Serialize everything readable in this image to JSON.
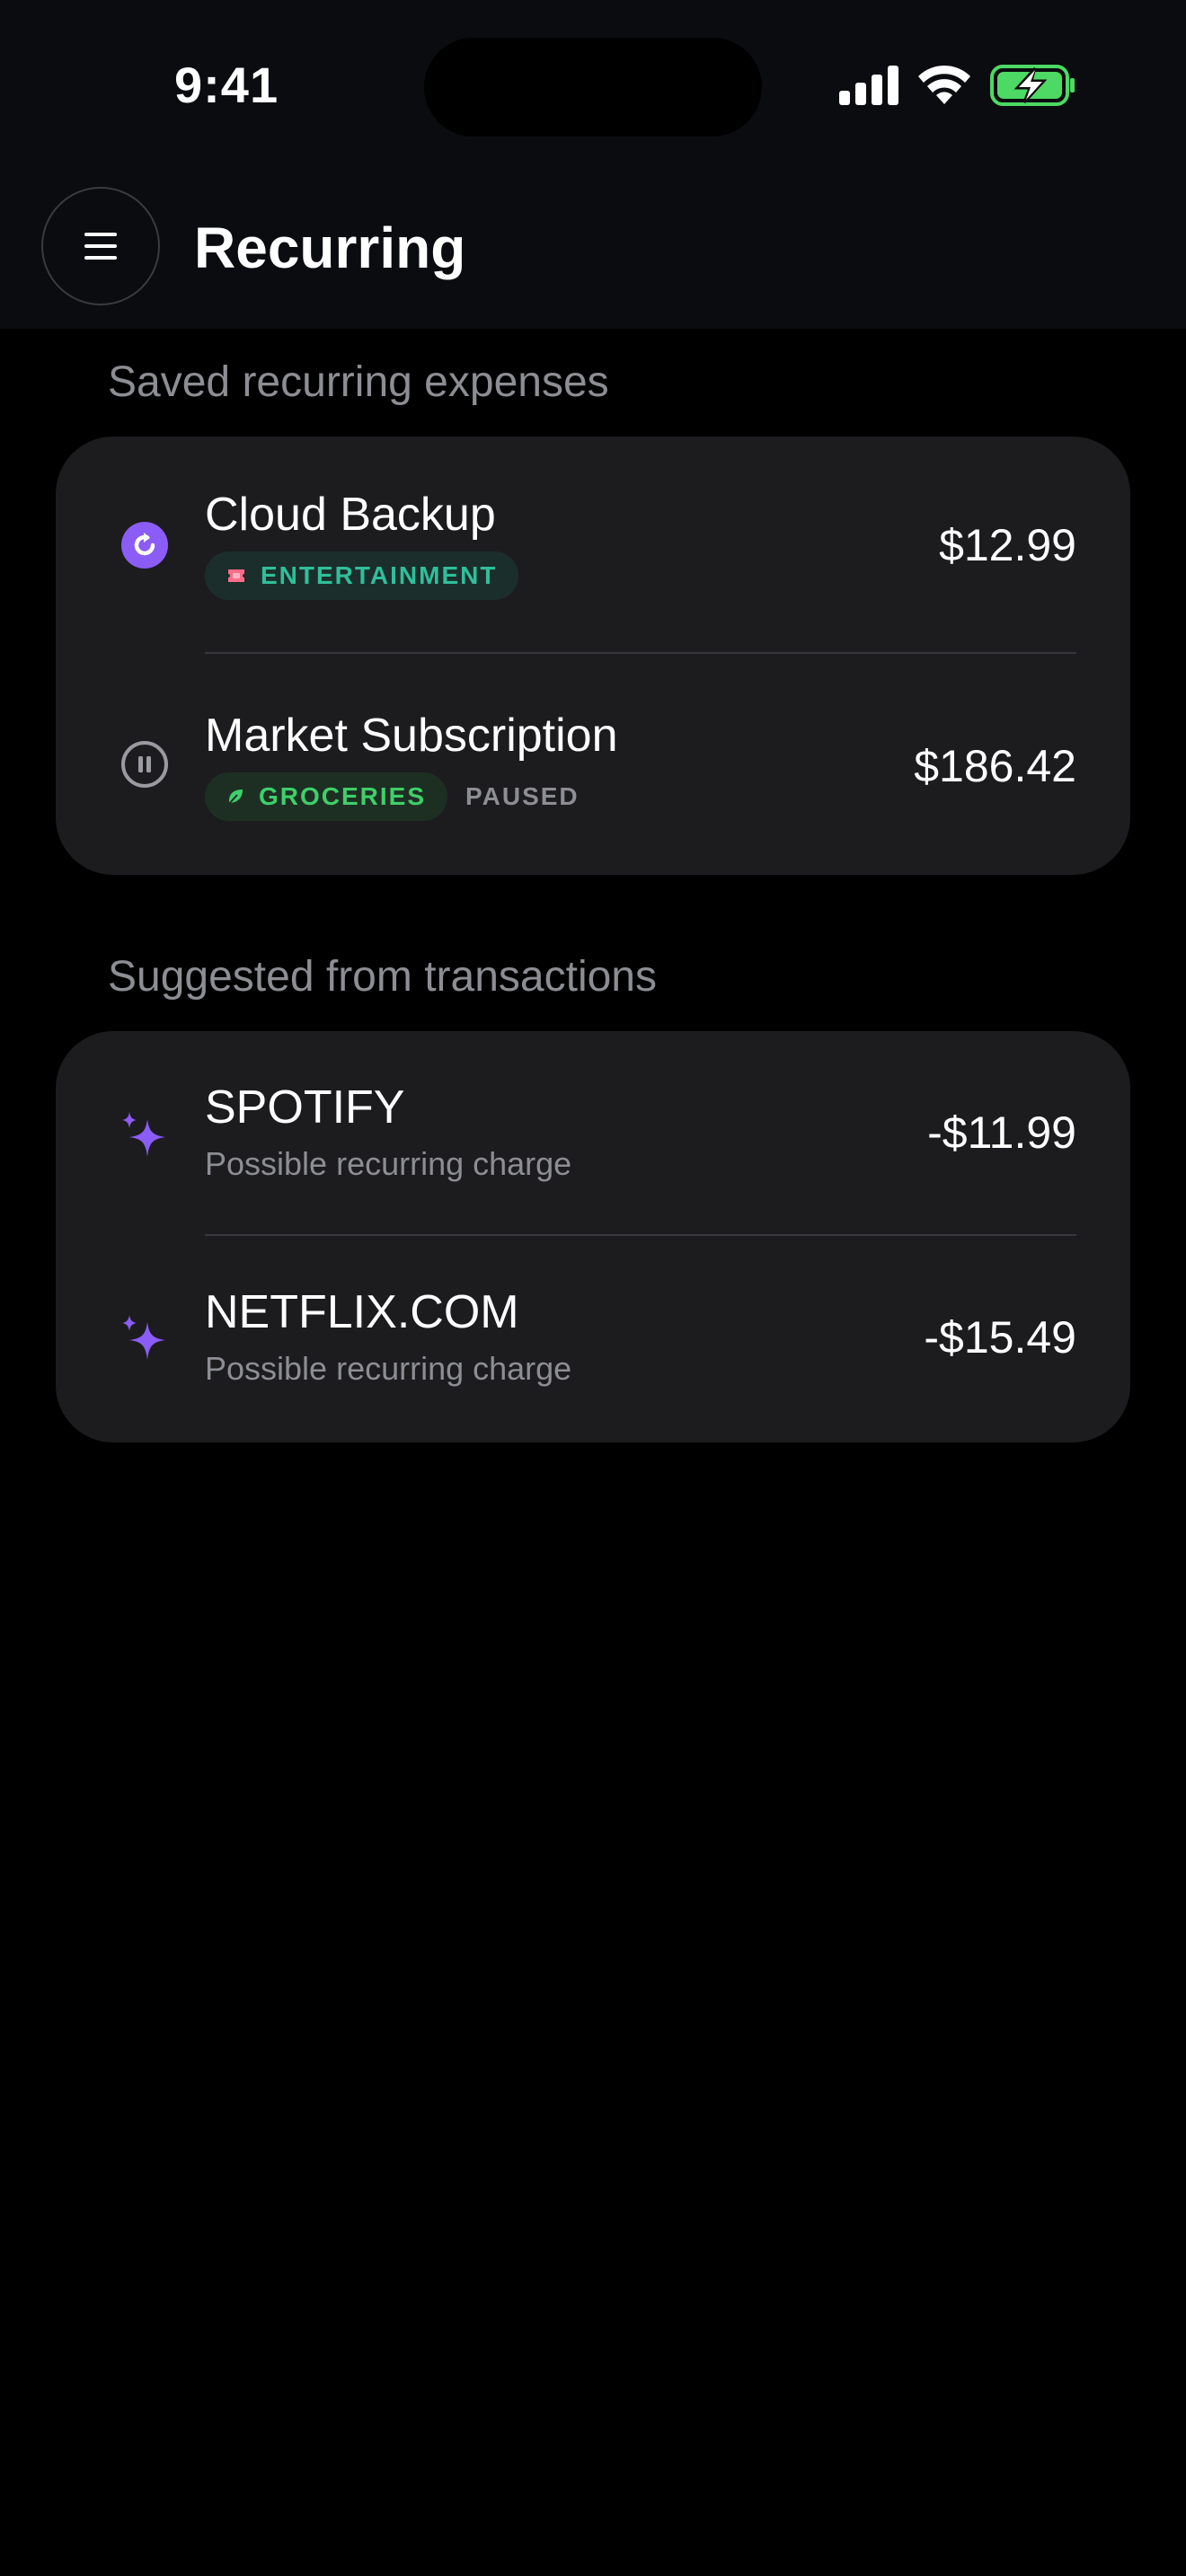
{
  "status_bar": {
    "time": "9:41"
  },
  "header": {
    "title": "Recurring",
    "menu_icon": "hamburger-menu-icon"
  },
  "saved_section": {
    "label": "Saved recurring expenses",
    "items": [
      {
        "name": "Cloud Backup",
        "amount": "$12.99",
        "category": "ENTERTAINMENT",
        "category_icon": "ticket-icon",
        "status_icon": "recurring-active-icon",
        "status": ""
      },
      {
        "name": "Market Subscription",
        "amount": "$186.42",
        "category": "GROCERIES",
        "category_icon": "leaf-icon",
        "status_icon": "pause-icon",
        "status": "PAUSED"
      }
    ]
  },
  "suggested_section": {
    "label": "Suggested from transactions",
    "items": [
      {
        "name": "SPOTIFY",
        "subtitle": "Possible recurring charge",
        "amount": "-$11.99",
        "icon": "sparkle-icon"
      },
      {
        "name": "NETFLIX.COM",
        "subtitle": "Possible recurring charge",
        "amount": "-$15.49",
        "icon": "sparkle-icon"
      }
    ]
  },
  "colors": {
    "accent_purple": "#8b5cf6",
    "entertainment_text": "#2fbf9b",
    "groceries_text": "#3fcf6a",
    "battery_green": "#4cd964"
  }
}
